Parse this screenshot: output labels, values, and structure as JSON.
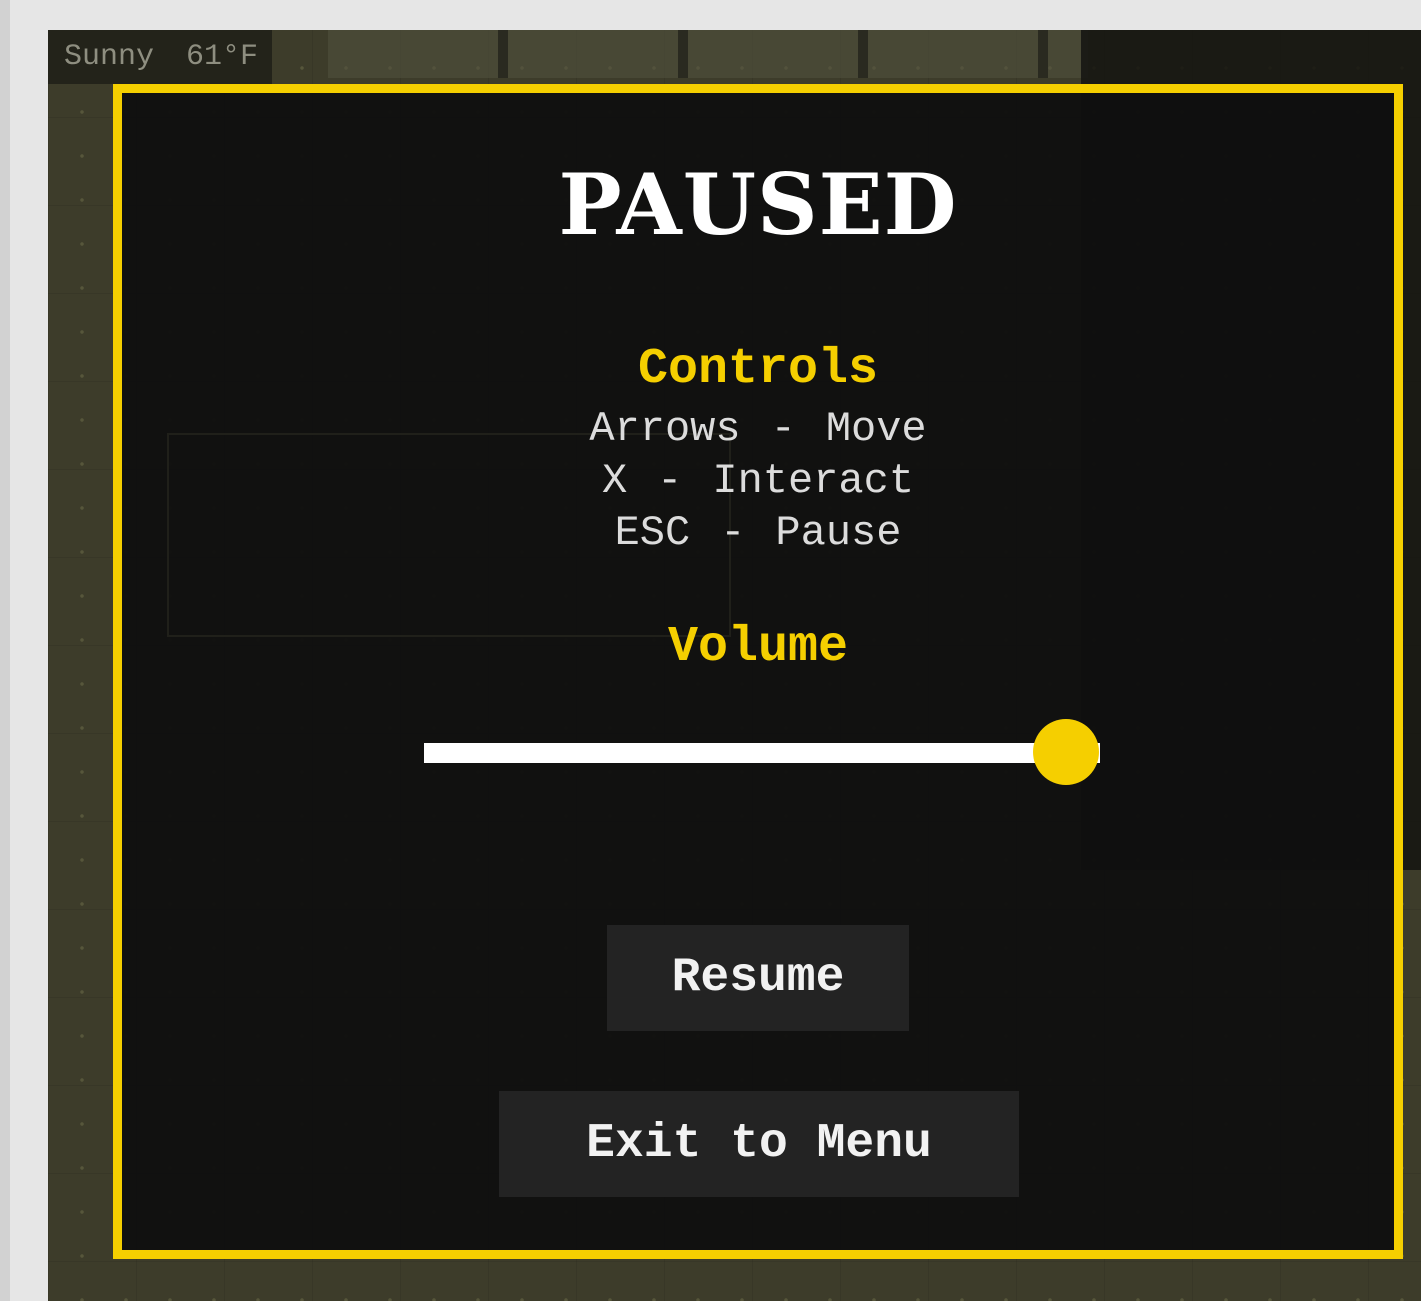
{
  "weather": {
    "condition": "Sunny",
    "temperature": "61°F"
  },
  "pause_menu": {
    "title": "PAUSED",
    "controls": {
      "heading": "Controls",
      "rows": [
        {
          "key": "Arrows",
          "sep": "-",
          "action": "Move"
        },
        {
          "key": "X",
          "sep": "-",
          "action": "Interact"
        },
        {
          "key": "ESC",
          "sep": "-",
          "action": "Pause"
        }
      ]
    },
    "volume": {
      "heading": "Volume",
      "level": 0.95
    },
    "buttons": {
      "resume": "Resume",
      "exit": "Exit to Menu"
    }
  },
  "colors": {
    "accent": "#f5cf00",
    "panel": "#101010",
    "button": "#232323"
  }
}
